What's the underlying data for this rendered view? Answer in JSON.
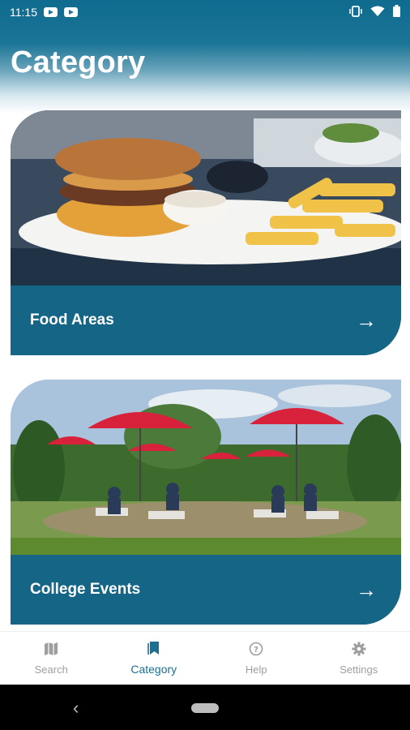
{
  "status_bar": {
    "time": "11:15"
  },
  "page_title": "Category",
  "cards": [
    {
      "label": "Food Areas",
      "arrow": "→",
      "image": "burger-and-fries-photo"
    },
    {
      "label": "College Events",
      "arrow": "→",
      "image": "outdoor-courtyard-umbrellas-photo"
    }
  ],
  "bottom_nav": [
    {
      "label": "Search",
      "icon": "map-icon",
      "active": false
    },
    {
      "label": "Category",
      "icon": "bookmark-icon",
      "active": true
    },
    {
      "label": "Help",
      "icon": "help-icon",
      "active": false
    },
    {
      "label": "Settings",
      "icon": "gear-icon",
      "active": false
    }
  ],
  "system_nav": {
    "back_glyph": "‹"
  },
  "colors": {
    "primary": "#156587",
    "header_top": "#0f6c8f",
    "active_nav": "#1a6f93",
    "inactive_nav": "#9e9e9e"
  }
}
